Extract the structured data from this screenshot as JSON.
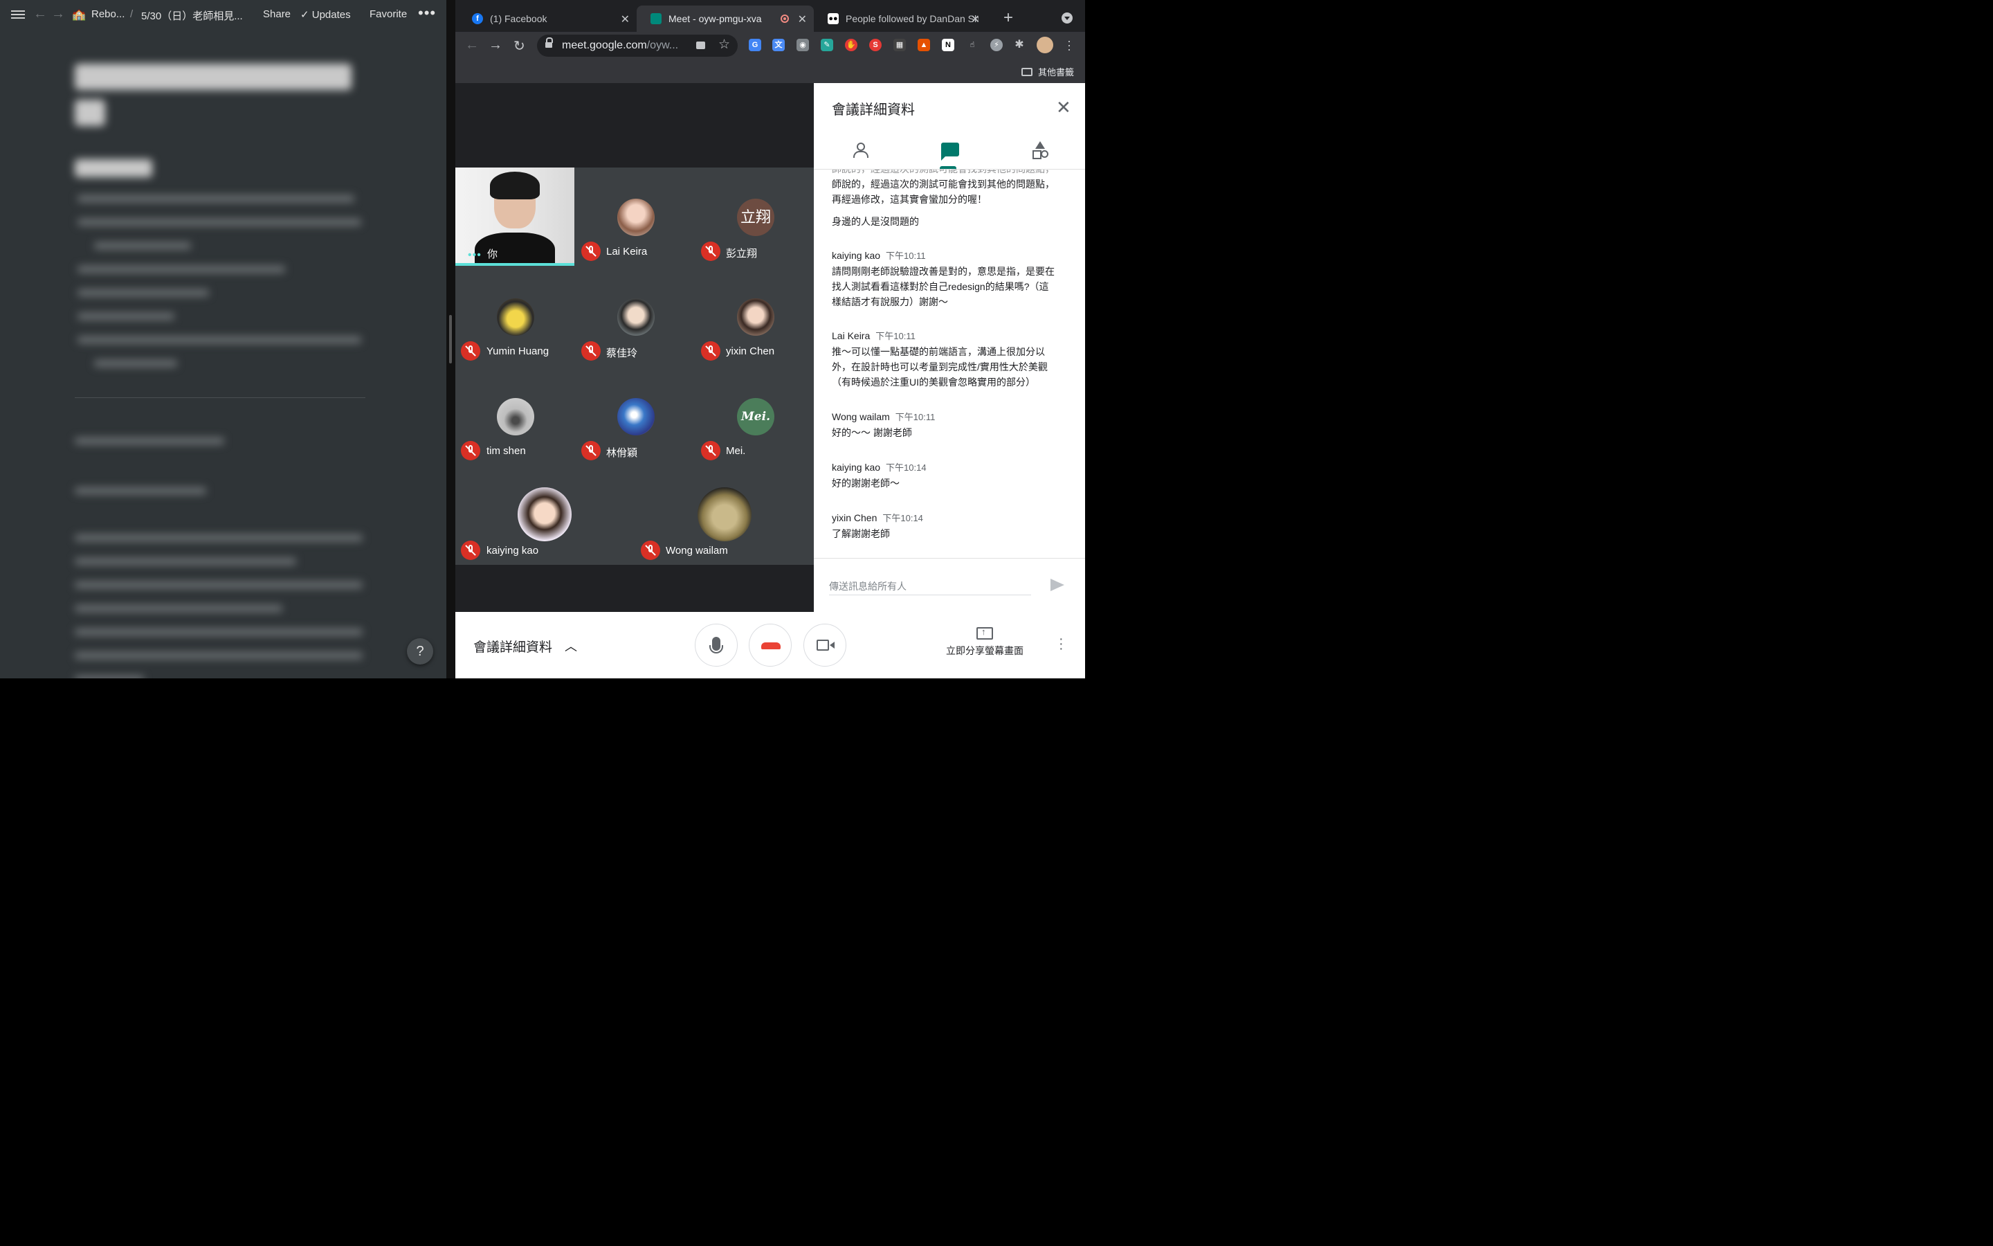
{
  "notion": {
    "breadcrumb_1": "Rebo...",
    "breadcrumb_sep": "/",
    "breadcrumb_2": "5/30（日）老師相見...",
    "share": "Share",
    "updates": "Updates",
    "favorite": "Favorite",
    "more": "•••",
    "help": "?"
  },
  "browser": {
    "tabs": [
      {
        "title": "(1) Facebook",
        "icon_color": "#1877f2"
      },
      {
        "title": "Meet - oyw-pmgu-xva",
        "icon_color": "#00897b"
      },
      {
        "title": "People followed by DanDan Sh",
        "icon_color": "#202124"
      }
    ],
    "url_host": "meet.google.com",
    "url_path": "/oyw...",
    "bookmark_folder": "其他書籤"
  },
  "meet": {
    "self_name": "你",
    "participants": [
      {
        "name": "Lai Keira",
        "avatar": "photo",
        "avatar_color": "#c9a38a"
      },
      {
        "name": "彭立翔",
        "avatar_text": "立翔",
        "avatar_color": "#6d4c41"
      },
      {
        "name": "Yumin Huang",
        "avatar": "photo",
        "avatar_color": "#c8b63a"
      },
      {
        "name": "蔡佳玲",
        "avatar": "photo",
        "avatar_color": "#8fa3a8"
      },
      {
        "name": "yixin Chen",
        "avatar": "photo",
        "avatar_color": "#b98a78"
      },
      {
        "name": "tim shen",
        "avatar": "photo",
        "avatar_color": "#9e9e9e"
      },
      {
        "name": "林佾穎",
        "avatar": "photo",
        "avatar_color": "#3a78c8"
      },
      {
        "name": "Mei.",
        "avatar_text": "Mei.",
        "avatar_color": "#4b7d5a"
      },
      {
        "name": "kaiying kao",
        "avatar": "cartoon",
        "avatar_color": "#f1d7c4"
      },
      {
        "name": "Wong wailam",
        "avatar": "photo",
        "avatar_color": "#c9b98a"
      }
    ]
  },
  "panel": {
    "title": "會議詳細資料",
    "partial_top": "師說的，經過這次的測試可能會找到其他的問題點，再經過修改，這其實會蠻加分的喔！",
    "partial_line": "身邊的人是沒問題的",
    "messages": [
      {
        "sender": "kaiying kao",
        "time": "下午10:11",
        "text": "請問剛剛老師說驗證改善是對的，意思是指，是要在找人測試看看這樣對於自己redesign的結果嗎?（這樣結語才有說服力）謝謝～"
      },
      {
        "sender": "Lai Keira",
        "time": "下午10:11",
        "text": "推～可以懂一點基礎的前端語言，溝通上很加分以外，在設計時也可以考量到完成性/實用性大於美觀（有時候過於注重UI的美觀會忽略實用的部分）"
      },
      {
        "sender": "Wong wailam",
        "time": "下午10:11",
        "text": "好的～～ 謝謝老師"
      },
      {
        "sender": "kaiying kao",
        "time": "下午10:14",
        "text": "好的謝謝老師～"
      },
      {
        "sender": "yixin Chen",
        "time": "下午10:14",
        "text": "了解謝謝老師"
      }
    ],
    "input_placeholder": "傳送訊息給所有人"
  },
  "controls": {
    "details_label": "會議詳細資料",
    "present_label": "立即分享螢幕畫面"
  }
}
